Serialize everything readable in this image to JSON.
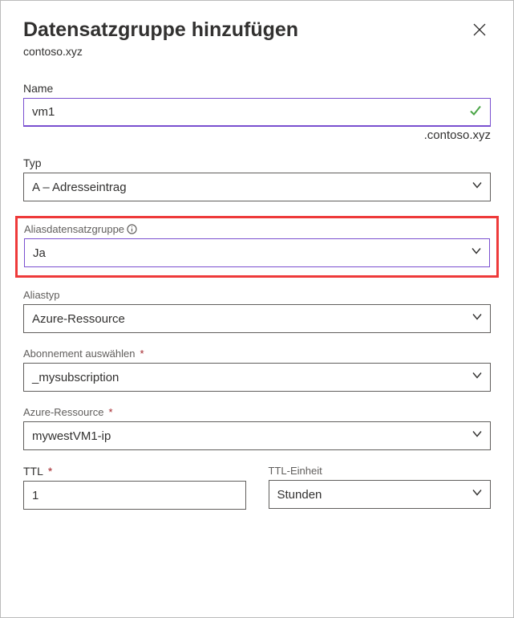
{
  "header": {
    "title": "Datensatzgruppe hinzufügen",
    "subtitle": "contoso.xyz"
  },
  "fields": {
    "name": {
      "label": "Name",
      "value": "vm1",
      "suffix": ".contoso.xyz"
    },
    "type": {
      "label": "Typ",
      "value": "A – Adresseintrag"
    },
    "alias_group": {
      "label": "Aliasdatensatzgruppe",
      "value": "Ja"
    },
    "alias_type": {
      "label": "Aliastyp",
      "value": "Azure-Ressource"
    },
    "subscription": {
      "label": "Abonnement auswählen",
      "value": "_mysubscription"
    },
    "resource": {
      "label": "Azure-Ressource",
      "value": "mywestVM1-ip"
    },
    "ttl": {
      "label": "TTL",
      "value": "1"
    },
    "ttl_unit": {
      "label": "TTL-Einheit",
      "value": "Stunden"
    }
  }
}
